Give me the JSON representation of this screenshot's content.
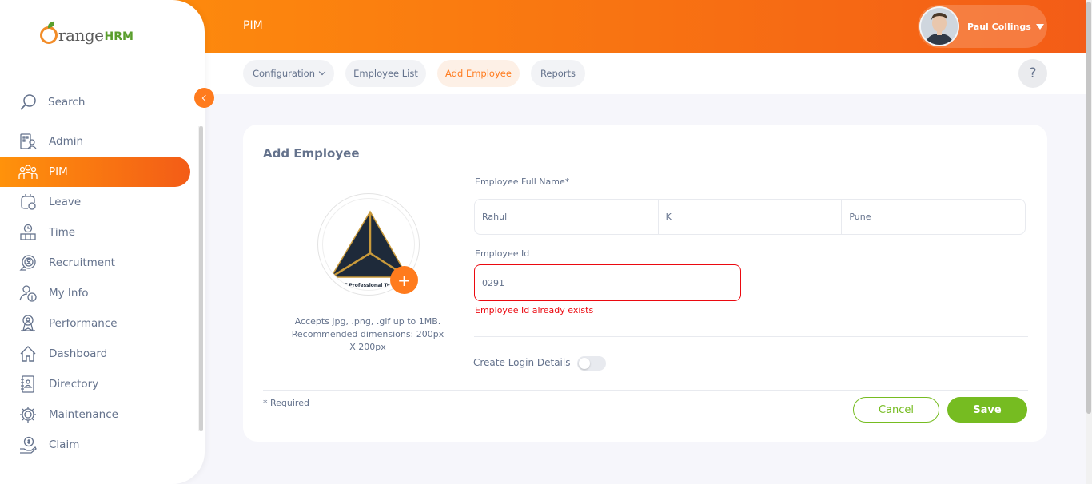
{
  "header": {
    "module_title": "PIM",
    "user": {
      "name": "Paul Collings",
      "avatar_icon": "user-avatar"
    }
  },
  "subnav": {
    "tabs": [
      {
        "label": "Configuration",
        "has_dropdown": true
      },
      {
        "label": "Employee List"
      },
      {
        "label": "Add Employee",
        "active": true
      },
      {
        "label": "Reports"
      }
    ],
    "help_label": "?"
  },
  "sidebar": {
    "logo": {
      "first": "range",
      "second": "HRM"
    },
    "search_label": "Search",
    "items": [
      {
        "label": "Admin",
        "icon": "admin-icon"
      },
      {
        "label": "PIM",
        "icon": "pim-icon",
        "active": true
      },
      {
        "label": "Leave",
        "icon": "leave-icon"
      },
      {
        "label": "Time",
        "icon": "time-icon"
      },
      {
        "label": "Recruitment",
        "icon": "recruitment-icon"
      },
      {
        "label": "My Info",
        "icon": "my-info-icon"
      },
      {
        "label": "Performance",
        "icon": "performance-icon"
      },
      {
        "label": "Dashboard",
        "icon": "dashboard-icon"
      },
      {
        "label": "Directory",
        "icon": "directory-icon"
      },
      {
        "label": "Maintenance",
        "icon": "maintenance-icon"
      },
      {
        "label": "Claim",
        "icon": "claim-icon"
      }
    ]
  },
  "form": {
    "title": "Add Employee",
    "photo": {
      "image_text": "IT Professional Trainings",
      "add_label": "+",
      "caption": "Accepts jpg, .png, .gif up to 1MB. Recommended dimensions: 200px X 200px"
    },
    "full_name_label": "Employee Full Name*",
    "first_name": "Rahul",
    "middle_name": "K",
    "last_name": "Pune",
    "employee_id_label": "Employee Id",
    "employee_id": "0291",
    "employee_id_error": "Employee Id already exists",
    "create_login_label": "Create Login Details",
    "create_login_enabled": false,
    "required_note": "* Required",
    "cancel_label": "Cancel",
    "save_label": "Save"
  },
  "colors": {
    "brand_orange": "#ff7b1d",
    "brand_green": "#76bc21",
    "error_red": "#eb0910",
    "text_gray": "#64728c"
  }
}
